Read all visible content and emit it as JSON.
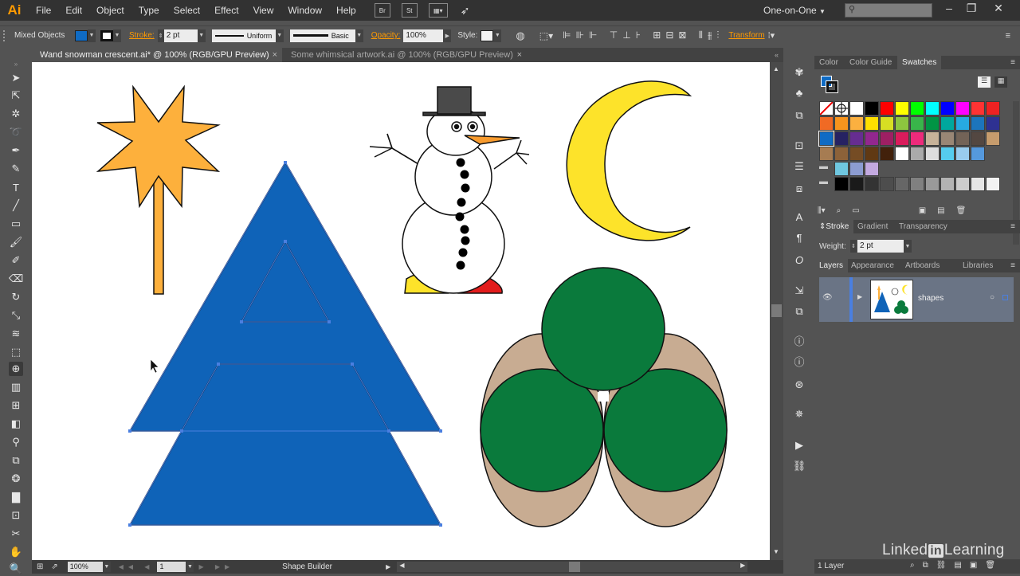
{
  "menubar": {
    "logo": "Ai",
    "items": [
      "File",
      "Edit",
      "Object",
      "Type",
      "Select",
      "Effect",
      "View",
      "Window",
      "Help"
    ],
    "bridge_icon": "Br",
    "stock_icon": "St",
    "workspace": "One-on-One"
  },
  "control": {
    "selection_label": "Mixed Objects",
    "stroke_label": "Stroke:",
    "stroke_weight": "2 pt",
    "profile": "Uniform",
    "brush": "Basic",
    "opacity_label": "Opacity:",
    "opacity_value": "100%",
    "style_label": "Style:",
    "transform_label": "Transform",
    "fill_color": "#0f6bc4"
  },
  "tabs": [
    {
      "label": "Wand snowman crescent.ai* @ 100% (RGB/GPU Preview)",
      "active": true
    },
    {
      "label": "Some whimsical artwork.ai @ 100% (RGB/GPU Preview)",
      "active": false
    }
  ],
  "status": {
    "zoom": "100%",
    "artboard": "1",
    "tool": "Shape Builder"
  },
  "panels": {
    "color_tabs": [
      "Color",
      "Color Guide",
      "Swatches"
    ],
    "stroke_tabs": [
      "Stroke",
      "Gradient",
      "Transparency"
    ],
    "weight_label": "Weight:",
    "weight_value": "2 pt",
    "layer_tabs": [
      "Layers",
      "Appearance",
      "Artboards",
      "Libraries"
    ],
    "layer_name": "shapes",
    "layer_count": "1 Layer"
  },
  "brand": {
    "left": "Linked",
    "in": "in",
    "right": "Learning"
  },
  "colors": {
    "tree_blue": "#0f63b8",
    "star_orange": "#fdb03c",
    "moon_yellow": "#fde32a",
    "bush_green": "#0a7a3c",
    "bush_tan": "#c8ac92",
    "selection": "#4a7fe0"
  },
  "icons": {
    "tools": [
      "selection-tool-icon",
      "direct-selection-tool-icon",
      "magic-wand-tool-icon",
      "lasso-tool-icon",
      "pen-tool-icon",
      "curvature-tool-icon",
      "type-tool-icon",
      "line-tool-icon",
      "rectangle-tool-icon",
      "paintbrush-tool-icon",
      "shaper-tool-icon",
      "eraser-tool-icon",
      "rotate-tool-icon",
      "scale-tool-icon",
      "warp-tool-icon",
      "free-transform-tool-icon",
      "shape-builder-tool-icon",
      "perspective-grid-tool-icon",
      "mesh-tool-icon",
      "gradient-tool-icon",
      "eyedropper-tool-icon",
      "blend-tool-icon",
      "symbol-sprayer-tool-icon",
      "column-graph-tool-icon",
      "artboard-tool-icon",
      "slice-tool-icon",
      "hand-tool-icon",
      "zoom-tool-icon"
    ]
  }
}
